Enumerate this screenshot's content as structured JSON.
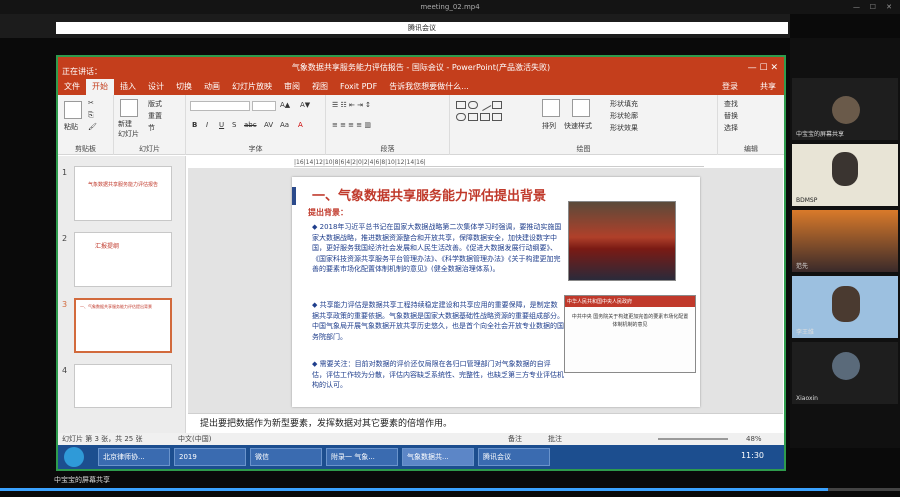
{
  "player": {
    "title": "meeting_02.mp4",
    "progress": 0.92
  },
  "share": {
    "title": "腾讯会议",
    "sharer": "中宝宝的屏幕共享"
  },
  "ppt": {
    "window_title": "气象数据共享服务能力评估报告 - 国际会议 - PowerPoint(产品激活失败)",
    "user": "登录",
    "share_btn": "共享",
    "speaker_tag": "正在讲话：",
    "tabs": [
      "文件",
      "开始",
      "插入",
      "设计",
      "切换",
      "动画",
      "幻灯片放映",
      "审阅",
      "视图",
      "Foxit PDF",
      "告诉我您想要做什么..."
    ],
    "active_tab": "开始",
    "ribbon": {
      "clipboard": {
        "paste": "粘贴",
        "label": "剪贴板"
      },
      "slides": {
        "new": "新建\n幻灯片",
        "layout": "版式",
        "reset": "重置",
        "section": "节",
        "label": "幻灯片"
      },
      "font": {
        "label": "字体",
        "format": [
          "B",
          "I",
          "U",
          "S",
          "abc",
          "AV",
          "Aa",
          "A"
        ]
      },
      "paragraph": {
        "label": "段落"
      },
      "drawing": {
        "arrange": "排列",
        "quick": "快速样式",
        "fill": "形状填充",
        "outline": "形状轮廓",
        "effects": "形状效果",
        "label": "绘图"
      },
      "editing": {
        "find": "查找",
        "replace": "替换",
        "select": "选择",
        "label": "编辑"
      }
    },
    "ruler": "|16|14|12|10|8|6|4|2|0|2|4|6|8|10|12|14|16|",
    "thumbs": [
      {
        "num": "1",
        "title": "气象数据共享服务能力评估报告"
      },
      {
        "num": "2",
        "title": "汇报提纲"
      },
      {
        "num": "3",
        "title": "一、气象数据共享服务能力评估提出背景"
      },
      {
        "num": "4",
        "title": ""
      }
    ],
    "slide": {
      "title": "一、气象数据共享服务能力评估提出背景",
      "subtitle": "提出背景：",
      "bullets": [
        "2018年习近平总书记在国家大数据战略第二次集体学习时强调，要推动实施国家大数据战略，推进数据资源整合和开放共享，保障数据安全，加快建设数字中国，更好服务我国经济社会发展和人民生活改善。《促进大数据发展行动纲要》、《国家科技资源共享服务平台管理办法》、《科学数据管理办法》《关于构建更加完善的要素市场化配置体制机制的意见》(健全数据治理体系)。",
        "共享能力评估是数据共享工程持续稳定建设和共享应用的重要保障，是制定数据共享政策的重要依据。气象数据是国家大数据基础性战略资源的重要组成部分。中国气象局开展气象数据开放共享历史悠久，也是首个向全社会开放专业数据的国务院部门。",
        "需要关注：目前对数据的评价还仅局限在各归口管理部门对气象数据的自评估，评估工作较为分散，评估内容缺乏系统性、完整性，也缺乏第三方专业评估机构的认可。"
      ],
      "doc_title": "中共中央 国务院关于构建更加完善的要素市场化配置体制机制的意见",
      "doc_header": "中华人民共和国中央人民政府"
    },
    "notes": "提出要把数据作为新型要素，发挥数据对其它要素的倍增作用。",
    "status": {
      "slide": "幻灯片 第 3 张，共 25 张",
      "lang": "中文(中国)",
      "notes": "备注",
      "comments": "批注",
      "zoom": "48%"
    },
    "taskbar": {
      "items": [
        "北京律师协...",
        "2019",
        "微信",
        "附录一 气象...",
        "气象数据共...",
        "腾讯会议"
      ],
      "time": "11:30"
    }
  },
  "participants": [
    {
      "name": "中宝宝的屏幕共享"
    },
    {
      "name": "BDMSP"
    },
    {
      "name": "范先"
    },
    {
      "name": "李王维"
    },
    {
      "name": "Xiaoxin"
    }
  ]
}
